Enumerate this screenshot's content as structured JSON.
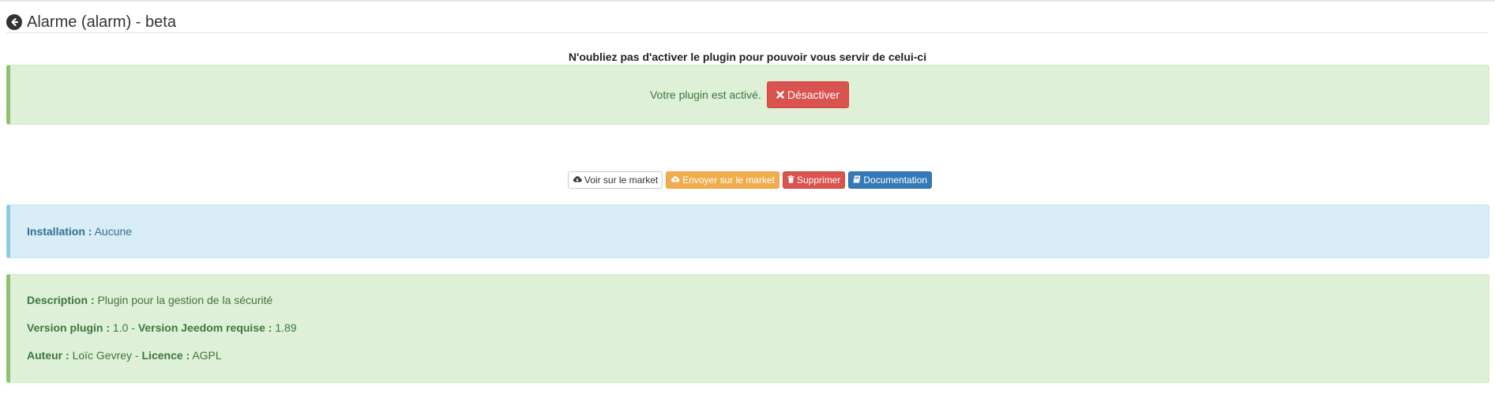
{
  "header": {
    "title": "Alarme (alarm) - beta",
    "back_icon": "arrow-circle-left-icon"
  },
  "notice": {
    "text": "N'oubliez pas d'activer le plugin pour pouvoir vous servir de celui-ci"
  },
  "status": {
    "text": "Votre plugin est activé.",
    "deactivate_label": "Désactiver",
    "deactivate_icon": "times-icon",
    "color": "#d9534f"
  },
  "actions": [
    {
      "label": "Voir sur le market",
      "icon": "cloud-download-icon",
      "style": "default",
      "color": "#ffffff"
    },
    {
      "label": "Envoyer sur le market",
      "icon": "cloud-upload-icon",
      "style": "warning",
      "color": "#f0ad4e"
    },
    {
      "label": "Supprimer",
      "icon": "trash-icon",
      "style": "danger",
      "color": "#d9534f"
    },
    {
      "label": "Documentation",
      "icon": "book-icon",
      "style": "primary",
      "color": "#337ab7"
    }
  ],
  "installation": {
    "label": "Installation :",
    "value": "Aucune"
  },
  "details": {
    "description_label": "Description :",
    "description_value": "Plugin pour la gestion de la sécurité",
    "version_label": "Version plugin :",
    "version_value": "1.0",
    "sep1": " - ",
    "jeedom_label": "Version Jeedom requise :",
    "jeedom_value": "1.89",
    "author_label": "Auteur :",
    "author_value": "Loïc Gevrey",
    "sep2": " - ",
    "licence_label": "Licence :",
    "licence_value": "AGPL"
  }
}
